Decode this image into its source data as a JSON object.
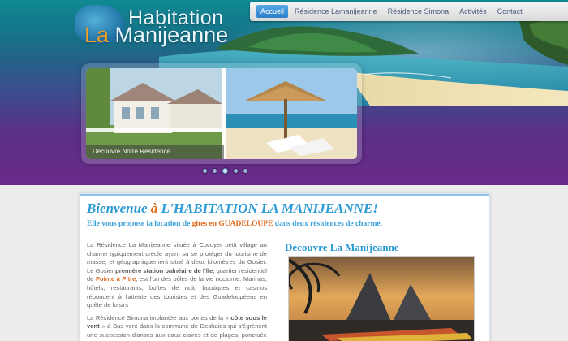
{
  "logo": {
    "line1": "Habitation",
    "line2_la": "La",
    "line2_rest": " Manijeanne"
  },
  "nav": {
    "items": [
      {
        "label": "Accueil",
        "active": true
      },
      {
        "label": "Résidence Lamanijeanne",
        "active": false
      },
      {
        "label": "Résidence Simona",
        "active": false
      },
      {
        "label": "Activités",
        "active": false
      },
      {
        "label": "Contact",
        "active": false
      }
    ]
  },
  "slider": {
    "caption": "Découvre Notre Résidence",
    "dots": 5,
    "active_dot": 3
  },
  "content": {
    "welcome_pre": "Bienvenue ",
    "welcome_a": "à",
    "welcome_post": " L'HABITATION LA MANIJEANNE!",
    "tagline_pre": "Elle vous propose la location de ",
    "tagline_link": "gites en GUADELOUPE",
    "tagline_post": " dans deux résidences de charme.",
    "para1_a": "La Résidence La Manijeanne située  à Cocoyer petit  village au charme typiquement créole ayant su se protéger du tourisme de masse, et géographiquement situé  à deux kilomètres du Gosier. Le Gosier ",
    "para1_b": "première station balnéaire de l'île",
    "para1_c": ", quartier résidentiel de ",
    "para1_link": "Pointe à Pitre",
    "para1_d": ",  est l'un des pôles de la vie nocturne. Marinas, hôtels, restaurants, boîtes de nuit, boutiques et casinos répondent à l'attente des touristes et des Guadeloupéens en quête de loisirs",
    "para2_a": "La Résidence Simona  implantée aux portes de la « ",
    "para2_b": "côte sous le vent",
    "para2_c": " » à Bas vent dans la commune de  Deshaies  qui s'égrènent une succession d'anses aux eaux claires et de plages, ponctuée de promontoires rocheux et abrupts. Vous",
    "right_title": "Découvre La Manijeanne"
  },
  "colors": {
    "accent_blue": "#2b9bd6",
    "accent_orange": "#e26a1d",
    "nav_active": "#2b7fc8"
  }
}
